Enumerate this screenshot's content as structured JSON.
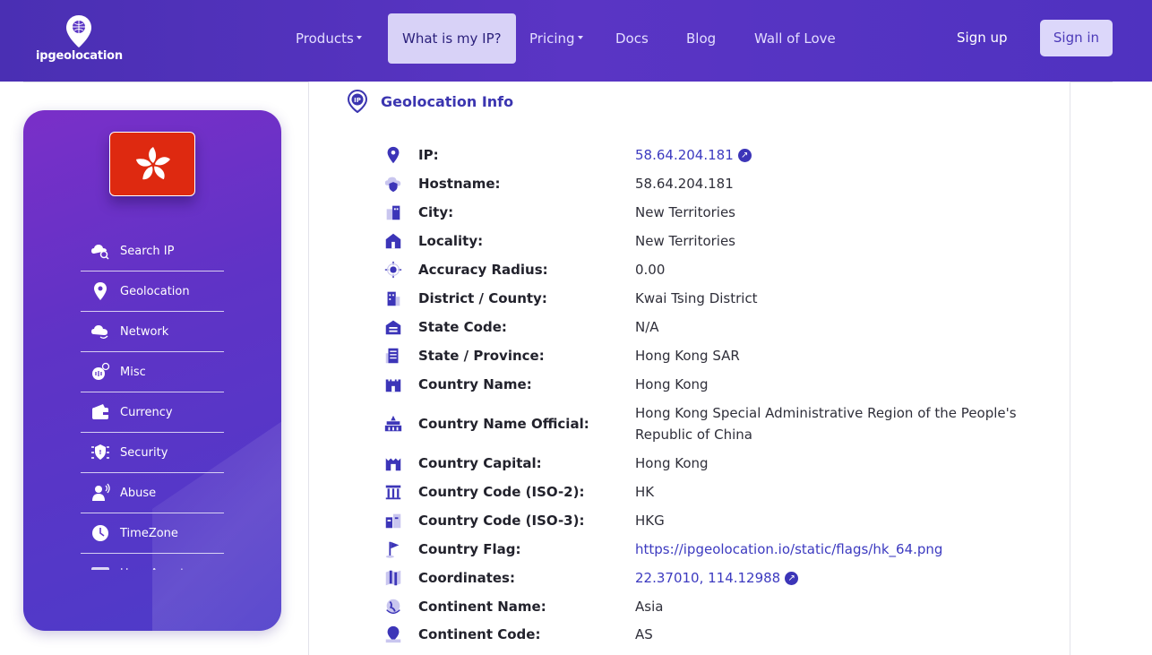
{
  "app": {
    "logo_text": "ipgeolocation"
  },
  "nav": {
    "products": "Products",
    "what_is_my_ip": "What is my IP?",
    "pricing": "Pricing",
    "docs": "Docs",
    "blog": "Blog",
    "wall_of_love": "Wall of Love",
    "sign_up": "Sign up",
    "sign_in": "Sign in"
  },
  "sidebar": {
    "items": [
      {
        "label": "Search IP",
        "icon": "cloud-search-icon"
      },
      {
        "label": "Geolocation",
        "icon": "map-pin-icon"
      },
      {
        "label": "Network",
        "icon": "cloud-network-icon"
      },
      {
        "label": "Misc",
        "icon": "misc-icon"
      },
      {
        "label": "Currency",
        "icon": "wallet-icon"
      },
      {
        "label": "Security",
        "icon": "shield-icon"
      },
      {
        "label": "Abuse",
        "icon": "user-alert-icon"
      },
      {
        "label": "TimeZone",
        "icon": "clock-icon"
      },
      {
        "label": "User Agent",
        "icon": "user-card-icon"
      }
    ],
    "flag": "hong-kong-flag-icon"
  },
  "panel": {
    "title": "Geolocation Info",
    "rows": [
      {
        "label": "IP:",
        "value": "58.64.204.181",
        "link": true,
        "external": true
      },
      {
        "label": "Hostname:",
        "value": "58.64.204.181"
      },
      {
        "label": "City:",
        "value": "New Territories"
      },
      {
        "label": "Locality:",
        "value": "New Territories"
      },
      {
        "label": "Accuracy Radius:",
        "value": "0.00"
      },
      {
        "label": "District / County:",
        "value": "Kwai Tsing District"
      },
      {
        "label": "State Code:",
        "value": "N/A"
      },
      {
        "label": "State / Province:",
        "value": "Hong Kong SAR"
      },
      {
        "label": "Country Name:",
        "value": "Hong Kong"
      },
      {
        "label": "Country Name Official:",
        "value": "Hong Kong Special Administrative Region of the People's Republic of China"
      },
      {
        "label": "Country Capital:",
        "value": "Hong Kong"
      },
      {
        "label": "Country Code (ISO-2):",
        "value": "HK"
      },
      {
        "label": "Country Code (ISO-3):",
        "value": "HKG"
      },
      {
        "label": "Country Flag:",
        "value": "https://ipgeolocation.io/static/flags/hk_64.png",
        "link": true
      },
      {
        "label": "Coordinates:",
        "value": "22.37010, 114.12988",
        "link": true,
        "external": true
      },
      {
        "label": "Continent Name:",
        "value": "Asia"
      },
      {
        "label": "Continent Code:",
        "value": "AS"
      }
    ]
  },
  "colors": {
    "brand": "#4f32c0",
    "accent": "#3c35b8",
    "flag_red": "#de2910"
  }
}
